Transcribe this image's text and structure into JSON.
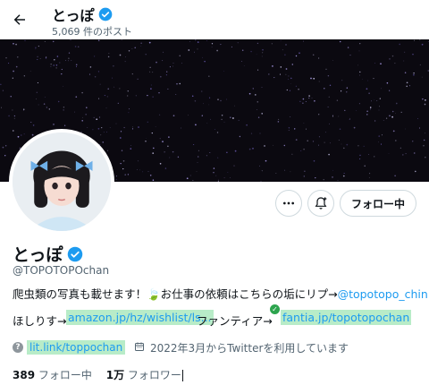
{
  "header": {
    "back_icon": "arrow-left-icon",
    "name": "とっぽ",
    "post_count": "5,069 件のポスト"
  },
  "actions": {
    "more_icon": "more-horizontal-icon",
    "notify_icon": "bell-plus-icon",
    "follow_label": "フォロー中"
  },
  "profile": {
    "name": "とっぽ",
    "handle": "@TOPOTOPOchan",
    "bio": {
      "line1_text": "爬虫類の写真も載せます！",
      "line1_leaf": "🍃",
      "line1_work": "お仕事の依頼はこちらの垢にリプ→",
      "line1_mention": "@topotopo_chin",
      "line2_prefix": "ほしりす→",
      "amazon_link": "amazon.jp/hz/wishlist/ls...",
      "fantia_label": "ファンティア→",
      "fantia_link": "fantia.jp/topotopochan"
    },
    "website": "lit.link/toppochan",
    "joined": "2022年3月からTwitterを利用しています"
  },
  "stats": {
    "following_count": "389",
    "following_label": "フォロー中",
    "followers_count": "1万",
    "followers_label": "フォロワー"
  },
  "colors": {
    "accent": "#1d9bf0",
    "highlight": "#b8ecc8",
    "banner": "#0b0910",
    "muted": "#536471"
  }
}
